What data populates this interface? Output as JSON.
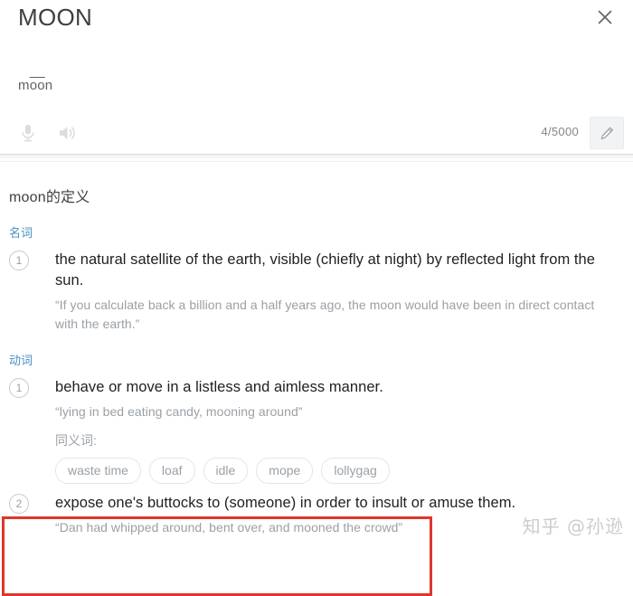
{
  "header": {
    "title": "MOON",
    "close_label": "×"
  },
  "word": {
    "respell_prefix": "m",
    "respell_macron": "oo",
    "respell_suffix": "n",
    "respell_full": "moon"
  },
  "toolbar": {
    "mic_label": "microphone",
    "speaker_label": "listen",
    "char_count": "4/5000",
    "edit_label": "edit"
  },
  "definitions": {
    "heading": "moon的定义",
    "pos_groups": [
      {
        "pos_label": "名词",
        "senses": [
          {
            "num": "1",
            "text": "the natural satellite of the earth, visible (chiefly at night) by reflected light from the sun.",
            "example": "“If you calculate back a billion and a half years ago, the moon would have been in direct contact with the earth.”"
          }
        ]
      },
      {
        "pos_label": "动词",
        "senses": [
          {
            "num": "1",
            "text": "behave or move in a listless and aimless manner.",
            "example": "“lying in bed eating candy, mooning around”"
          },
          {
            "num": "2",
            "text": "expose one's buttocks to (someone) in order to insult or amuse them.",
            "example": "“Dan had whipped around, bent over, and mooned the crowd”"
          }
        ],
        "synonyms": {
          "label": "同义词:",
          "items": [
            "waste time",
            "loaf",
            "idle",
            "mope",
            "lollygag"
          ]
        }
      }
    ]
  },
  "annotation": {
    "highlight_color": "#e0362c"
  },
  "watermark": {
    "text": "知乎 @孙逊"
  }
}
